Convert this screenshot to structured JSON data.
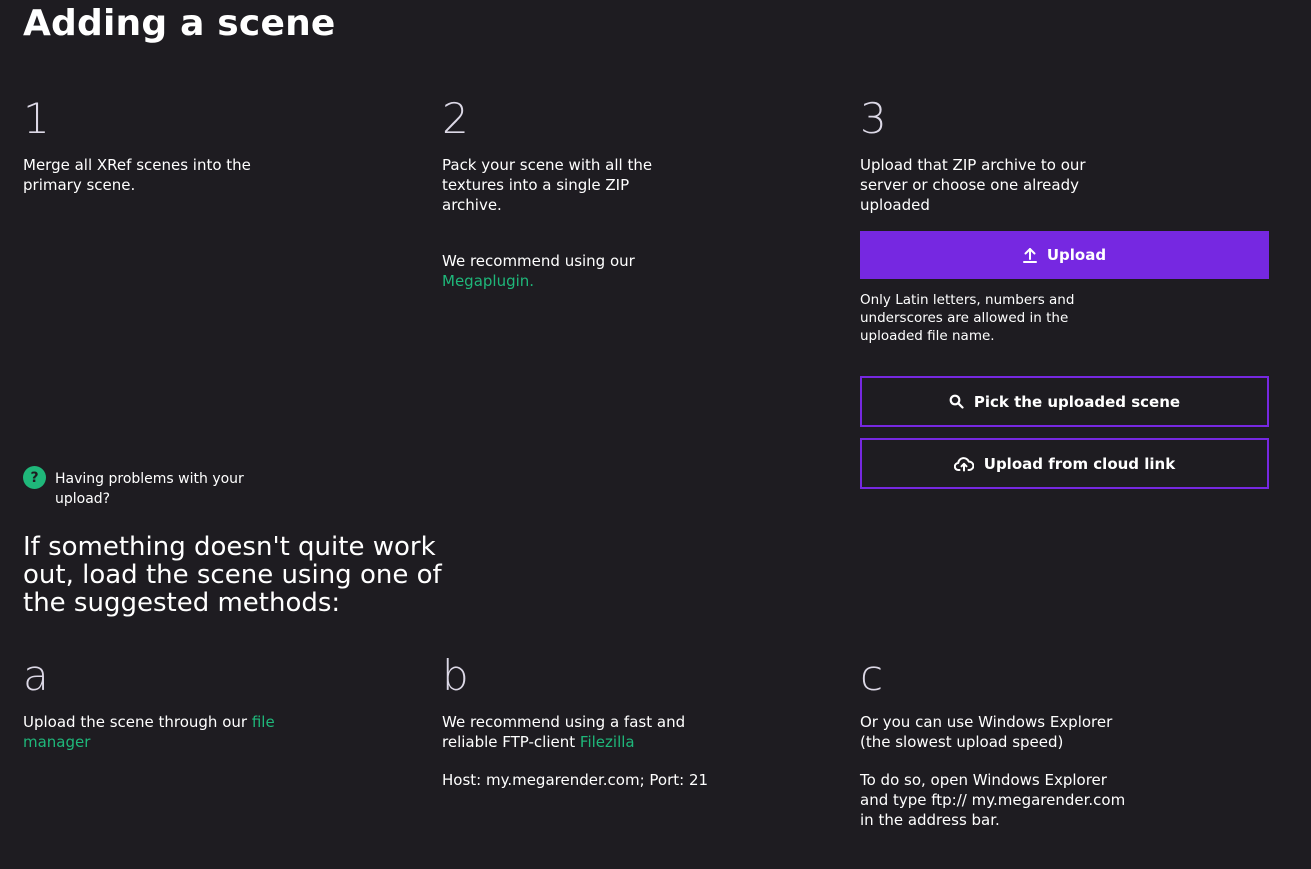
{
  "page": {
    "title": "Adding a scene"
  },
  "steps": [
    {
      "number": "1",
      "text": "Merge all XRef scenes into the primary scene."
    },
    {
      "number": "2",
      "text": "Pack your scene with all the textures into a single ZIP archive.",
      "recommend_prefix": "We recommend using our",
      "recommend_link": "Megaplugin."
    },
    {
      "number": "3",
      "text": "Upload that ZIP archive to our server or choose one already uploaded",
      "upload_button": "Upload",
      "upload_note": "Only Latin letters, numbers and underscores are allowed in the uploaded file name.",
      "pick_button": "Pick the uploaded scene",
      "cloud_button": "Upload from cloud link"
    }
  ],
  "help": {
    "icon_glyph": "?",
    "text": "Having problems with your upload?"
  },
  "alternatives": {
    "heading": "If something doesn't quite work out, load the scene using one of the suggested methods:",
    "items": [
      {
        "letter": "a",
        "text_prefix": "Upload the scene through our",
        "link": "file manager"
      },
      {
        "letter": "b",
        "text_prefix": "We recommend using a fast and reliable FTP-client",
        "link": "Filezilla",
        "host_info": "Host: my.megarender.com; Port: 21"
      },
      {
        "letter": "c",
        "text": "Or you can use Windows Explorer (the slowest upload speed)",
        "instructions": "To do so, open Windows Explorer and type ftp:// my.megarender.com in the address bar."
      }
    ]
  },
  "colors": {
    "background": "#1e1c21",
    "accent": "#7628e1",
    "link": "#1fb77a"
  },
  "icons": {
    "upload": "upload-arrow-icon",
    "pick": "search-icon",
    "cloud": "cloud-upload-icon",
    "help": "question-icon"
  }
}
